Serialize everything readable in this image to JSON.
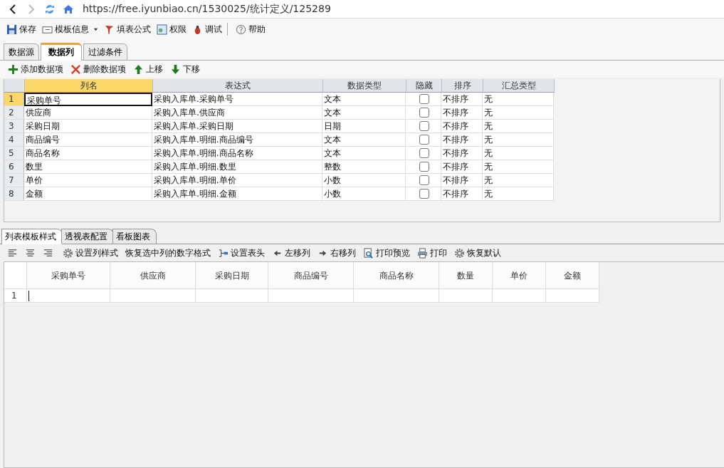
{
  "address_bar": {
    "url": "https://free.iyunbiao.cn/1530025/统计定义/125289"
  },
  "toolbar": [
    {
      "label": "保存",
      "has_menu": false
    },
    {
      "label": "模板信息",
      "has_menu": true
    },
    {
      "label": "填表公式",
      "has_menu": false
    },
    {
      "label": "权限",
      "has_menu": false
    },
    {
      "label": "调试",
      "has_menu": false
    },
    {
      "label": "帮助",
      "has_menu": false
    }
  ],
  "tabs": [
    {
      "label": "数据源",
      "selected": false
    },
    {
      "label": "数据列",
      "selected": true
    },
    {
      "label": "过滤条件",
      "selected": false
    }
  ],
  "actions": [
    "添加数据项",
    "删除数据项",
    "上移",
    "下移"
  ],
  "grid": {
    "columns": [
      {
        "label": "列名",
        "selected": true
      },
      {
        "label": "表达式",
        "selected": false
      },
      {
        "label": "数据类型",
        "selected": false
      },
      {
        "label": "隐藏",
        "selected": false
      },
      {
        "label": "排序",
        "selected": false
      },
      {
        "label": "汇总类型",
        "selected": false
      }
    ],
    "rows": [
      {
        "num": "1",
        "name": "采购单号",
        "expression": "采购入库单.采购单号",
        "type": "文本",
        "hidden": false,
        "sort": "不排序",
        "summary": "无",
        "selected": true
      },
      {
        "num": "2",
        "name": "供应商",
        "expression": "采购入库单.供应商",
        "type": "文本",
        "hidden": false,
        "sort": "不排序",
        "summary": "无",
        "selected": false
      },
      {
        "num": "3",
        "name": "采购日期",
        "expression": "采购入库单.采购日期",
        "type": "日期",
        "hidden": false,
        "sort": "不排序",
        "summary": "无",
        "selected": false
      },
      {
        "num": "4",
        "name": "商品编号",
        "expression": "采购入库单.明细.商品编号",
        "type": "文本",
        "hidden": false,
        "sort": "不排序",
        "summary": "无",
        "selected": false
      },
      {
        "num": "5",
        "name": "商品名称",
        "expression": "采购入库单.明细.商品名称",
        "type": "文本",
        "hidden": false,
        "sort": "不排序",
        "summary": "无",
        "selected": false
      },
      {
        "num": "6",
        "name": "数里",
        "expression": "采购入库单.明细.数里",
        "type": "整数",
        "hidden": false,
        "sort": "不排序",
        "summary": "无",
        "selected": false
      },
      {
        "num": "7",
        "name": "单价",
        "expression": "采购入库单.明细.单价",
        "type": "小数",
        "hidden": false,
        "sort": "不排序",
        "summary": "无",
        "selected": false
      },
      {
        "num": "8",
        "name": "金额",
        "expression": "采购入库单.明细.金额",
        "type": "小数",
        "hidden": false,
        "sort": "不排序",
        "summary": "无",
        "selected": false
      }
    ]
  },
  "lower_tabs": [
    {
      "label": "列表模板样式",
      "selected": true
    },
    {
      "label": "透视表配置",
      "selected": false
    },
    {
      "label": "看板图表",
      "selected": false
    }
  ],
  "style_toolbar": [
    "设置列样式",
    "恢复选中列的数字格式",
    "设置表头",
    "左移列",
    "右移列",
    "打印预览",
    "打印",
    "恢复默认"
  ],
  "preview": {
    "columns": [
      "采购单号",
      "供应商",
      "采购日期",
      "商品编号",
      "商品名称",
      "数量",
      "单价",
      "金额"
    ],
    "rows": [
      {
        "num": "1"
      }
    ]
  }
}
